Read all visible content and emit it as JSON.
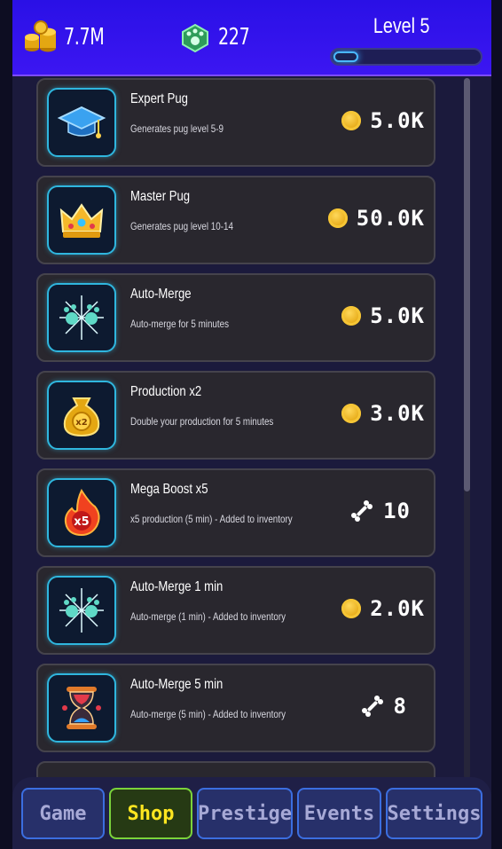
{
  "header": {
    "coins": "7.7M",
    "gems": "227",
    "level_label": "Level 5",
    "xp_progress": 0.17
  },
  "shop_items": [
    {
      "name": "Expert Pug",
      "description": "Generates pug level 5-9",
      "price": "5.0K",
      "currency": "coin",
      "icon": "graduation-cap-icon"
    },
    {
      "name": "Master Pug",
      "description": "Generates pug level 10-14",
      "price": "50.0K",
      "currency": "coin",
      "icon": "crown-icon"
    },
    {
      "name": "Auto-Merge",
      "description": "Auto-merge for 5 minutes",
      "price": "5.0K",
      "currency": "coin",
      "icon": "paw-sparkle-icon"
    },
    {
      "name": "Production x2",
      "description": "Double your production for 5 minutes",
      "price": "3.0K",
      "currency": "coin",
      "icon": "x2-coin-bag-icon"
    },
    {
      "name": "Mega Boost x5",
      "description": "x5 production (5 min) - Added to inventory",
      "price": "10",
      "currency": "bone",
      "icon": "x5-flame-icon"
    },
    {
      "name": "Auto-Merge 1 min",
      "description": "Auto-merge (1 min) - Added to inventory",
      "price": "2.0K",
      "currency": "coin",
      "icon": "paw-sparkle-icon"
    },
    {
      "name": "Auto-Merge 5 min",
      "description": "Auto-merge (5 min) - Added to inventory",
      "price": "8",
      "currency": "bone",
      "icon": "hourglass-icon"
    }
  ],
  "nav": {
    "game": "Game",
    "shop": "Shop",
    "prestige": "Prestige",
    "events": "Events",
    "settings": "Settings",
    "active": "Shop"
  },
  "colors": {
    "header_bg": "#3c16f2",
    "item_border": "#2fb6de",
    "active_tab_text": "#ffe620",
    "active_tab_border": "#7bd33a"
  }
}
